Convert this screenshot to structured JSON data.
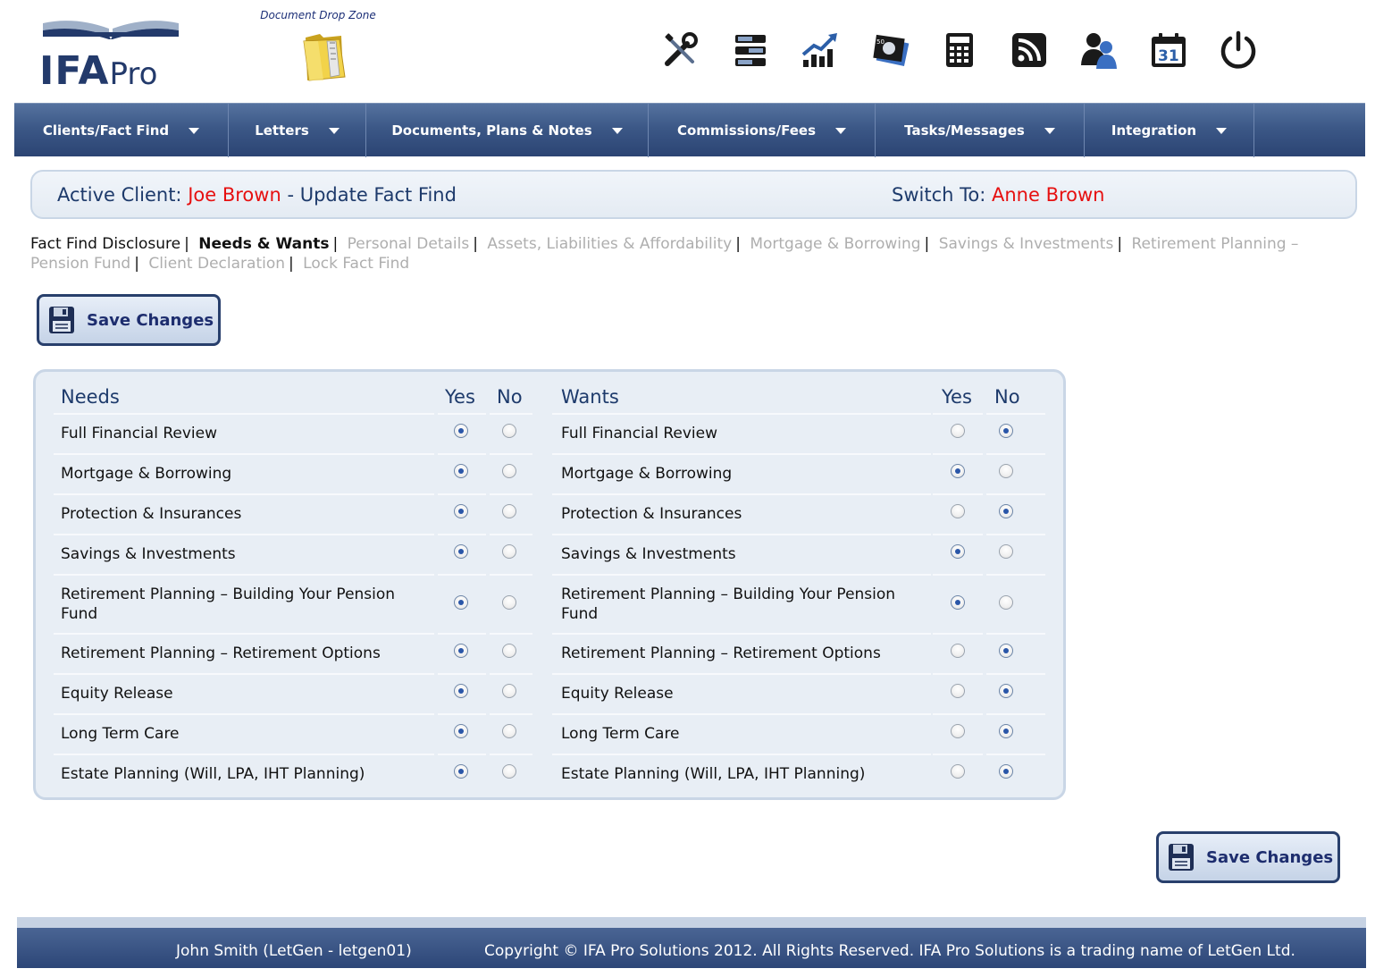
{
  "app": {
    "logo_ifa": "IFA",
    "logo_pro": "Pro",
    "dropzone_label": "Document Drop Zone"
  },
  "toolbar_icons": [
    "tools-icon",
    "servers-icon",
    "growth-chart-icon",
    "banknotes-icon",
    "calculator-icon",
    "rss-feed-icon",
    "users-icon",
    "calendar-icon",
    "power-icon"
  ],
  "calendar_day": "31",
  "nav": [
    {
      "label": "Clients/Fact Find"
    },
    {
      "label": "Letters"
    },
    {
      "label": "Documents, Plans & Notes"
    },
    {
      "label": "Commissions/Fees"
    },
    {
      "label": "Tasks/Messages"
    },
    {
      "label": "Integration"
    }
  ],
  "client": {
    "active_label": "Active Client:",
    "active_name": "Joe Brown",
    "dash": " - ",
    "mode": "Update Fact Find",
    "switch_label": "Switch To:",
    "switch_name": "Anne Brown"
  },
  "sections": [
    {
      "label": "Fact Find Disclosure",
      "state": "done"
    },
    {
      "label": "Needs & Wants",
      "state": "current"
    },
    {
      "label": "Personal Details",
      "state": "todo"
    },
    {
      "label": "Assets, Liabilities & Affordability",
      "state": "todo"
    },
    {
      "label": "Mortgage & Borrowing",
      "state": "todo"
    },
    {
      "label": "Savings & Investments",
      "state": "todo"
    },
    {
      "label": "Retirement Planning – Pension Fund",
      "state": "todo"
    },
    {
      "label": "Client Declaration",
      "state": "todo"
    },
    {
      "label": "Lock Fact Find",
      "state": "todo"
    }
  ],
  "section_separator": "|",
  "save_label": "Save Changes",
  "table": {
    "needs_header": "Needs",
    "wants_header": "Wants",
    "yes_header": "Yes",
    "no_header": "No",
    "rows": [
      {
        "label": "Full Financial Review",
        "need": "yes",
        "want": "no"
      },
      {
        "label": "Mortgage & Borrowing",
        "need": "yes",
        "want": "yes"
      },
      {
        "label": "Protection & Insurances",
        "need": "yes",
        "want": "no"
      },
      {
        "label": "Savings & Investments",
        "need": "yes",
        "want": "yes"
      },
      {
        "label": "Retirement Planning – Building Your Pension Fund",
        "need": "yes",
        "want": "yes"
      },
      {
        "label": "Retirement Planning – Retirement Options",
        "need": "yes",
        "want": "no"
      },
      {
        "label": "Equity Release",
        "need": "yes",
        "want": "no"
      },
      {
        "label": "Long Term Care",
        "need": "yes",
        "want": "no"
      },
      {
        "label": "Estate Planning (Will, LPA, IHT Planning)",
        "need": "yes",
        "want": "no"
      }
    ]
  },
  "footer": {
    "user": "John Smith (LetGen - letgen01)",
    "copyright": "Copyright © IFA Pro Solutions 2012. All Rights Reserved. IFA Pro Solutions is a trading name of LetGen Ltd."
  },
  "colors": {
    "nav_bg": "#3c5887",
    "accent_red": "#e61010",
    "text_navy": "#1d3a6b",
    "panel_bg": "#e8eef5"
  }
}
